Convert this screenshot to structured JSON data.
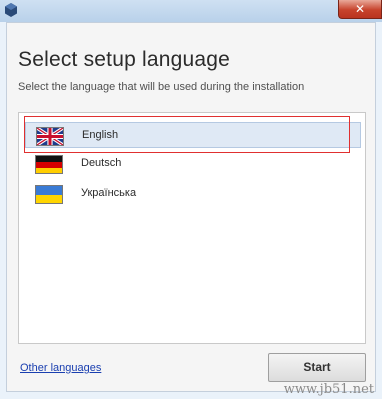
{
  "window": {
    "close_glyph": "✕"
  },
  "header": {
    "title": "Select setup language",
    "subtitle": "Select the language that will be used during the installation"
  },
  "languages": [
    {
      "label": "English",
      "flag": "uk-flag-icon",
      "selected": true
    },
    {
      "label": "Deutsch",
      "flag": "germany-flag-icon",
      "selected": false
    },
    {
      "label": "Українська",
      "flag": "ukraine-flag-icon",
      "selected": false
    }
  ],
  "footer": {
    "other_languages_label": "Other languages",
    "start_label": "Start"
  },
  "watermark": "www.jb51.net",
  "colors": {
    "highlight": "#e03030",
    "selected_row": "#dfe9f5",
    "link": "#1a3fb0"
  }
}
